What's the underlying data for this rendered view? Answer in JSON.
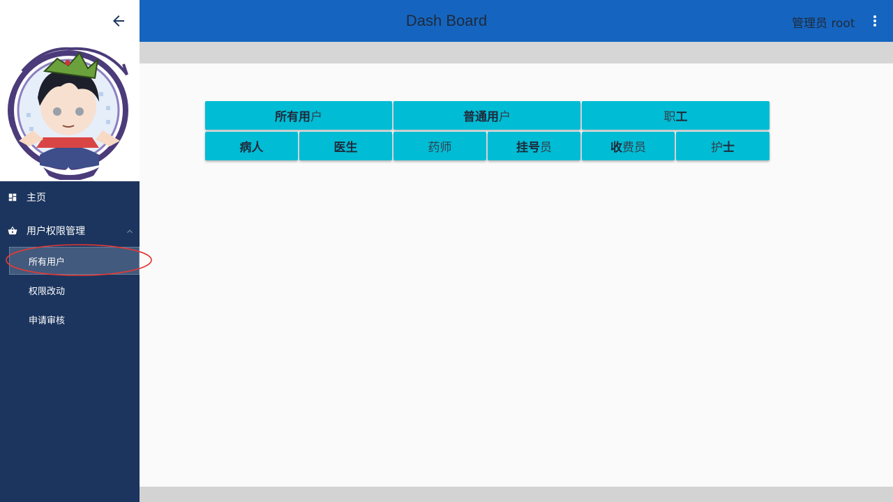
{
  "header": {
    "title": "Dash Board",
    "user_label": "管理员 root"
  },
  "sidebar": {
    "nav": [
      {
        "label": "主页",
        "icon": "dashboard-icon"
      },
      {
        "label": "用户权限管理",
        "icon": "basket-icon"
      }
    ],
    "subitems": [
      {
        "label": "所有用户",
        "active": true
      },
      {
        "label": "权限改动"
      },
      {
        "label": "申请审核"
      }
    ]
  },
  "buttons": {
    "row1": [
      {
        "bold": "所有用",
        "light": "户"
      },
      {
        "bold": "普通用",
        "light": "户"
      },
      {
        "light_prefix": "职",
        "bold": "工"
      }
    ],
    "row2": [
      {
        "bold": "病人"
      },
      {
        "bold": "医生"
      },
      {
        "light": "药师"
      },
      {
        "bold": "挂号",
        "light": "员"
      },
      {
        "bold": "收",
        "light": "费员"
      },
      {
        "light_prefix": "护",
        "bold": "士"
      }
    ]
  },
  "colors": {
    "header": "#1565c0",
    "sidebar": "#1c355e",
    "button": "#00bcd4",
    "highlight": "#e53935"
  }
}
